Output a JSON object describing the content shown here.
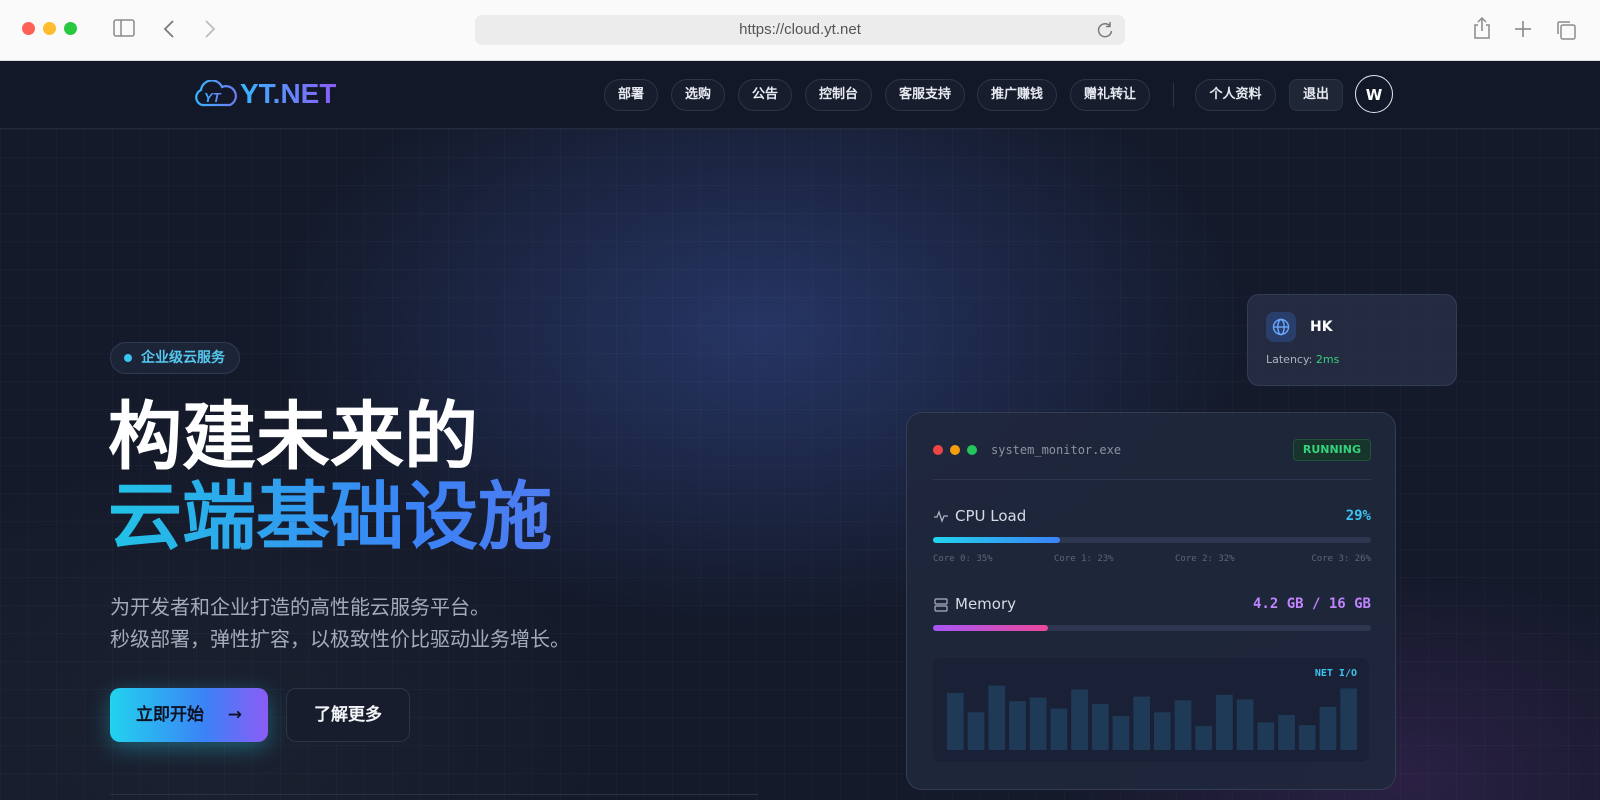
{
  "browser": {
    "url": "https://cloud.yt.net",
    "icons": [
      "sidebar-icon",
      "back-icon",
      "forward-icon",
      "reload-icon",
      "share-icon",
      "new-tab-icon",
      "tabs-overview-icon"
    ]
  },
  "nav": {
    "logo_text": "YT.NET",
    "links": [
      "部署",
      "选购",
      "公告",
      "控制台",
      "客服支持",
      "推广赚钱",
      "赠礼转让"
    ],
    "profile": "个人资料",
    "logout": "退出",
    "avatar": "W"
  },
  "hero": {
    "badge": "企业级云服务",
    "title_line1": "构建未来的",
    "title_line2": "云端基础设施",
    "subtitle_line1": "为开发者和企业打造的高性能云服务平台。",
    "subtitle_line2": "秒级部署，弹性扩容，以极致性价比驱动业务增长。",
    "primary_cta": "立即开始",
    "secondary_cta": "了解更多"
  },
  "region_card": {
    "name": "HK",
    "latency_label": "Latency:",
    "latency_value": "2ms"
  },
  "monitor": {
    "title": "system_monitor.exe",
    "status": "RUNNING",
    "cpu_label": "CPU Load",
    "cpu_value": "29%",
    "cpu_fraction": 0.29,
    "cores": [
      "Core 0: 35%",
      "Core 1: 23%",
      "Core 2: 32%",
      "Core 3: 26%"
    ],
    "memory_label": "Memory",
    "memory_value": "4.2 GB / 16 GB",
    "memory_fraction": 0.2625,
    "net_label": "NET I/O",
    "net_values": [
      0.62,
      0.41,
      0.7,
      0.53,
      0.57,
      0.45,
      0.66,
      0.5,
      0.37,
      0.58,
      0.41,
      0.54,
      0.26,
      0.6,
      0.55,
      0.3,
      0.38,
      0.27,
      0.47,
      0.67
    ]
  },
  "colors": {
    "accent_cyan": "#22d3ee",
    "accent_blue": "#3b82f6",
    "accent_purple": "#8b5cf6",
    "status_green": "#34d27d",
    "memory_purple": "#c084fc"
  }
}
